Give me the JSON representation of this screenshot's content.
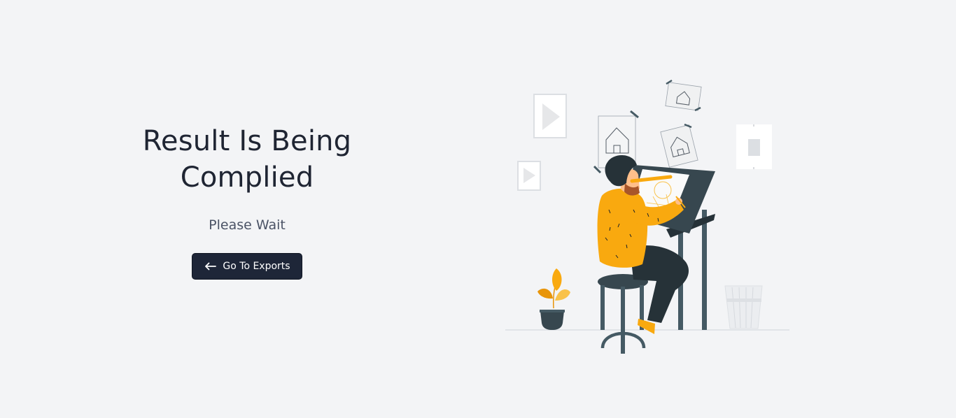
{
  "main": {
    "title_line1": "Result Is Being",
    "title_line2": "Complied",
    "subtitle": "Please Wait",
    "back_button_label": "Go To Exports",
    "back_button_icon": "arrow-left-icon"
  },
  "illustration": {
    "subject": "designer-at-drafting-table",
    "colors": {
      "accent": "#f9a90f",
      "dark": "#37474f",
      "background": "#f3f4f6"
    }
  }
}
